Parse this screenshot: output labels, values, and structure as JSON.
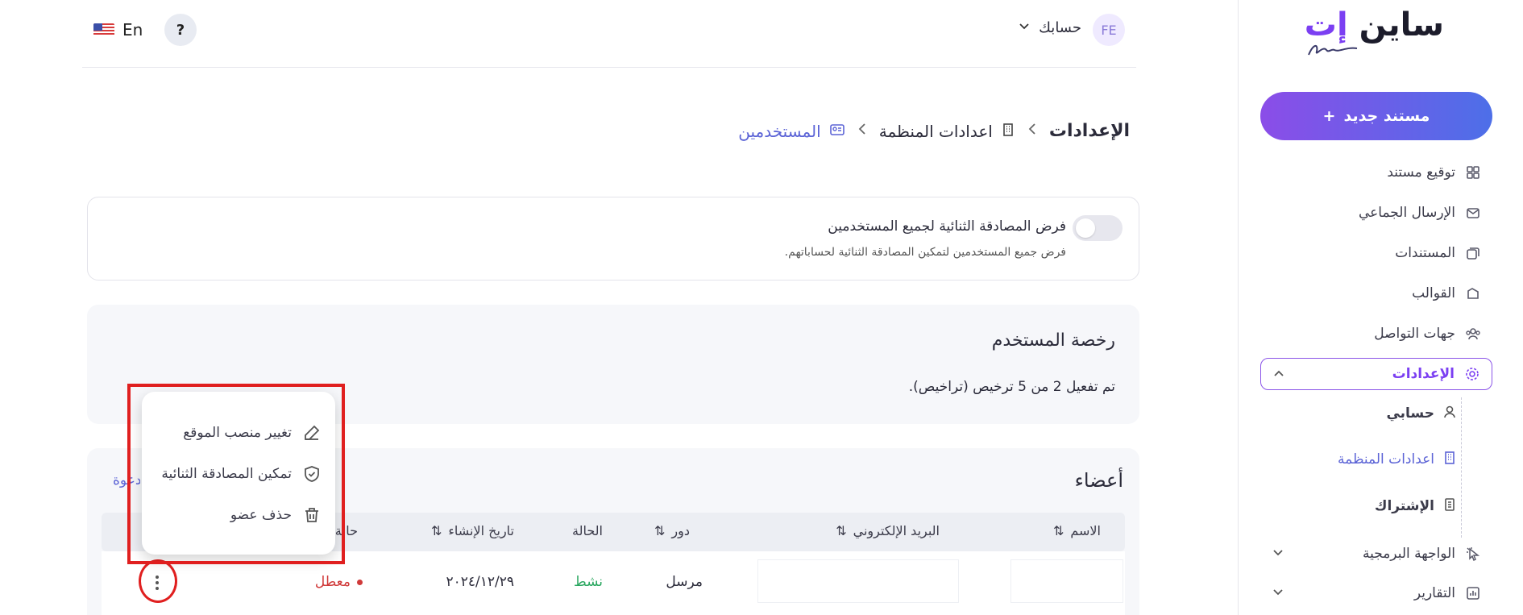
{
  "brand": {
    "name": "ساين",
    "name_accent": "إت"
  },
  "sidebar": {
    "new_document": "مستند جديد",
    "items": [
      {
        "label": "توقيع مستند",
        "icon": "grid-icon"
      },
      {
        "label": "الإرسال الجماعي",
        "icon": "mail-icon"
      },
      {
        "label": "المستندات",
        "icon": "documents-icon"
      },
      {
        "label": "القوالب",
        "icon": "template-icon"
      },
      {
        "label": "جهات التواصل",
        "icon": "contacts-icon"
      },
      {
        "label": "الإعدادات",
        "icon": "gear-icon"
      }
    ],
    "subitems": [
      {
        "label": "حسابي",
        "icon": "user-icon"
      },
      {
        "label": "اعدادات المنظمة",
        "icon": "building-icon"
      },
      {
        "label": "الإشتراك",
        "icon": "receipt-icon"
      }
    ],
    "bottom_items": [
      {
        "label": "الواجهة البرمجية",
        "icon": "pointer-icon"
      },
      {
        "label": "التقارير",
        "icon": "chart-icon"
      }
    ]
  },
  "topbar": {
    "avatar_initials": "FE",
    "account_label": "حسابك",
    "help_label": "?",
    "language": "En"
  },
  "breadcrumb": {
    "root": "الإعدادات",
    "org": "اعدادات المنظمة",
    "current": "المستخدمين"
  },
  "two_factor": {
    "title": "فرض المصادقة الثنائية لجميع المستخدمين",
    "description": "فرض جميع المستخدمين لتمكين المصادقة الثنائية لحساباتهم.",
    "enabled": false
  },
  "license": {
    "title": "رخصة المستخدم",
    "summary": "تم تفعيل 2 من 5 ترخيص (تراخيص)."
  },
  "members": {
    "title": "أعضاء",
    "invite_label": "دعوة",
    "columns": {
      "name": "الاسم",
      "email": "البريد الإلكتروني",
      "role": "دور",
      "status": "الحالة",
      "created": "تاريخ الإنشاء",
      "state": "حالة"
    },
    "rows": [
      {
        "name": "",
        "email": "",
        "role": "مرسل",
        "status": "نشط",
        "created": "٢٠٢٤/١٢/٢٩",
        "state": "معطل"
      }
    ]
  },
  "row_menu": {
    "items": [
      {
        "label": "تغيير منصب الموقع",
        "icon": "edit-icon"
      },
      {
        "label": "تمكين المصادقة الثنائية",
        "icon": "shield-icon"
      },
      {
        "label": "حذف عضو",
        "icon": "trash-icon"
      }
    ]
  },
  "colors": {
    "accent": "#7b3ff2",
    "link": "#5b63d6",
    "active_status": "#2aa760",
    "disabled_status": "#d03a3a",
    "highlight": "#e01f1f"
  }
}
